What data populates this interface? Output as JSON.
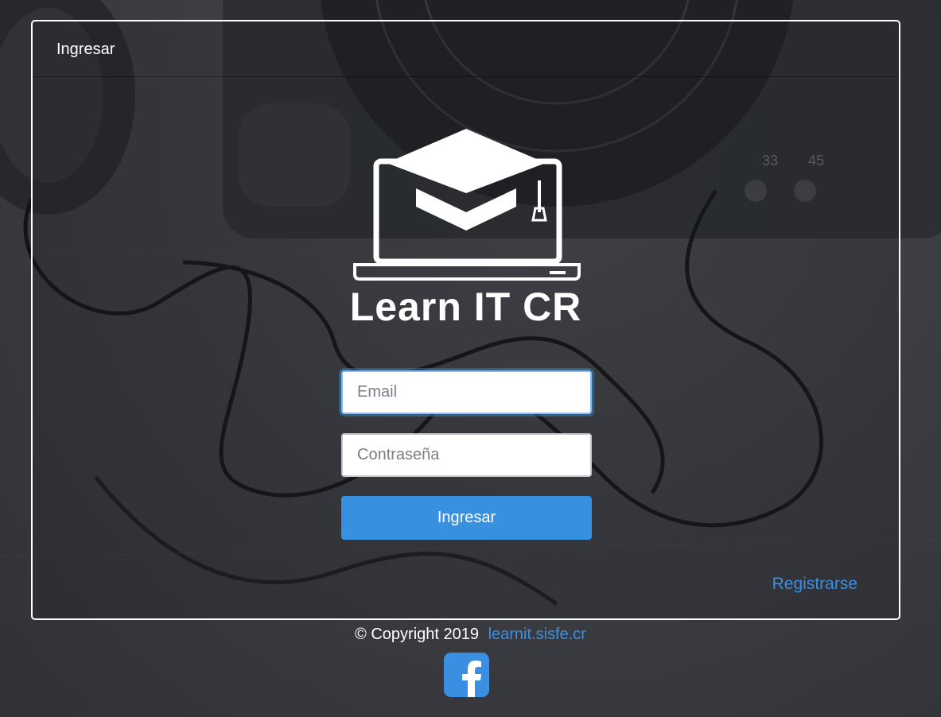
{
  "header": {
    "title": "Ingresar"
  },
  "brand": {
    "name": "Learn IT CR"
  },
  "form": {
    "email_placeholder": "Email",
    "password_placeholder": "Contraseña",
    "submit_label": "Ingresar"
  },
  "register_link": "Registrarse",
  "footer": {
    "copyright": "© Copyright 2019",
    "site_link": "learnit.sisfe.cr"
  },
  "icons": {
    "logo": "graduation-laptop-icon",
    "social": "facebook-icon"
  },
  "colors": {
    "accent": "#3791e0",
    "link": "#3d8fdf",
    "background": "#3b3d42",
    "facebook": "#3b8fe3"
  }
}
